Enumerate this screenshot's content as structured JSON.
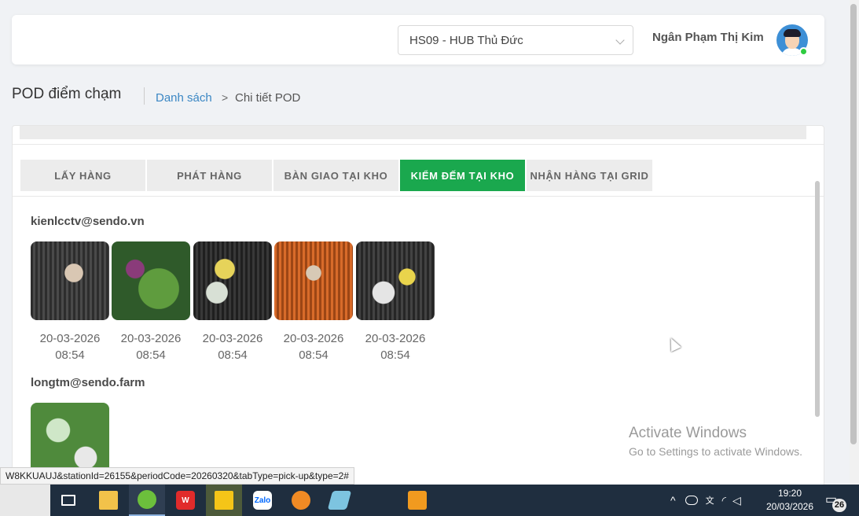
{
  "header": {
    "hub_select": "HS09 - HUB Thủ Đức",
    "user_name": "Ngân Phạm Thị Kim"
  },
  "breadcrumb": {
    "page_title": "POD điểm chạm",
    "link": "Danh sách",
    "separator": ">",
    "current": "Chi tiết POD"
  },
  "tabs": [
    {
      "label": "LẤY HÀNG",
      "active": false
    },
    {
      "label": "PHÁT HÀNG",
      "active": false
    },
    {
      "label": "BÀN GIAO TẠI KHO",
      "active": false
    },
    {
      "label": "KIỂM ĐẾM TẠI KHO",
      "active": true
    },
    {
      "label": "NHẬN HÀNG TẠI GRID",
      "active": false
    }
  ],
  "groups": [
    {
      "user": "kienlcctv@sendo.vn",
      "photos": [
        {
          "date": "20-03-2026",
          "time": "08:54"
        },
        {
          "date": "20-03-2026",
          "time": "08:54"
        },
        {
          "date": "20-03-2026",
          "time": "08:54"
        },
        {
          "date": "20-03-2026",
          "time": "08:54"
        },
        {
          "date": "20-03-2026",
          "time": "08:54"
        }
      ]
    },
    {
      "user": "longtm@sendo.farm",
      "photos": [
        {}
      ]
    }
  ],
  "watermark": {
    "title": "Activate Windows",
    "subtitle": "Go to Settings to activate Windows."
  },
  "status_url": "W8KKUAUJ&stationId=26155&periodCode=20260320&tabType=pick-up&type=2#",
  "taskbar": {
    "apps": [
      "task-view",
      "file-explorer",
      "browser",
      "wps-office",
      "sticky-notes",
      "zalo",
      "vpn",
      "editor",
      "sublime"
    ],
    "tray_language": "ENG",
    "time": "19:20",
    "date": "20/03/2026",
    "notification_count": "26"
  },
  "colors": {
    "active_tab": "#1aa84e",
    "link": "#3b87c4",
    "taskbar": "#1f2e3f"
  }
}
